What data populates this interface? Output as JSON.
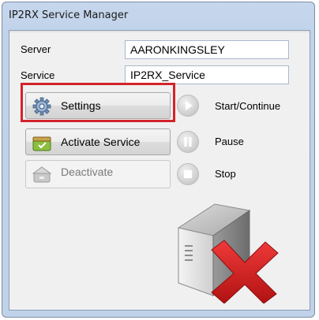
{
  "window": {
    "title": "IP2RX Service Manager"
  },
  "form": {
    "server_label": "Server",
    "server_value": "AARONKINGSLEY",
    "service_label": "Service",
    "service_value": "IP2RX_Service"
  },
  "buttons": {
    "settings": "Settings",
    "activate": "Activate Service",
    "deactivate": "Deactivate"
  },
  "controls": {
    "start": "Start/Continue",
    "pause": "Pause",
    "stop": "Stop"
  },
  "status": {
    "icon": "server-stopped-icon",
    "accent": "#d3232b"
  }
}
